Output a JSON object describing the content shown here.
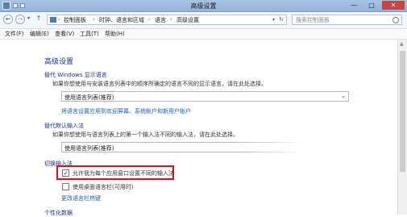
{
  "window": {
    "title": "高级设置",
    "controls": {
      "minimize": "—",
      "maximize": "□",
      "close": "✕"
    },
    "accent": "#d5151c"
  },
  "nav": {
    "back": "←",
    "forward": "→",
    "up": "↑",
    "breadcrumb": [
      "控制面板",
      "时钟、语言和区域",
      "语言",
      "高级设置"
    ],
    "separator": "›",
    "search_placeholder": "搜索控制面板"
  },
  "menu": [
    "文件(F)",
    "编辑(E)",
    "查看(V)",
    "工具(T)",
    "帮助(H)"
  ],
  "page": {
    "heading": "高级设置",
    "display_language": {
      "title": "替代 Windows 显示语言",
      "description": "如果你想使用与安装语言列表中的顺序所确定的语言不同的显示语言，请在此处选择。",
      "selected": "使用语言列表(推荐)",
      "link": "将语言设置应用到欢迎屏幕、系统帐户和新用户帐户"
    },
    "default_input": {
      "title": "替代默认输入法",
      "description": "如果你想使用与语言列表上的第一个输入法不同的输入法，请在此处选择。",
      "selected": "使用语言列表(推荐)"
    },
    "switch_input": {
      "title": "切换输入法",
      "option1": {
        "label": "允许我为每个应用窗口设置不同的输入法",
        "checked": true
      },
      "option2": {
        "label": "使用桌面语言栏(可用时)",
        "checked": false
      },
      "link": "更改语言栏热键"
    },
    "personalization": {
      "title": "个性化数据"
    }
  }
}
